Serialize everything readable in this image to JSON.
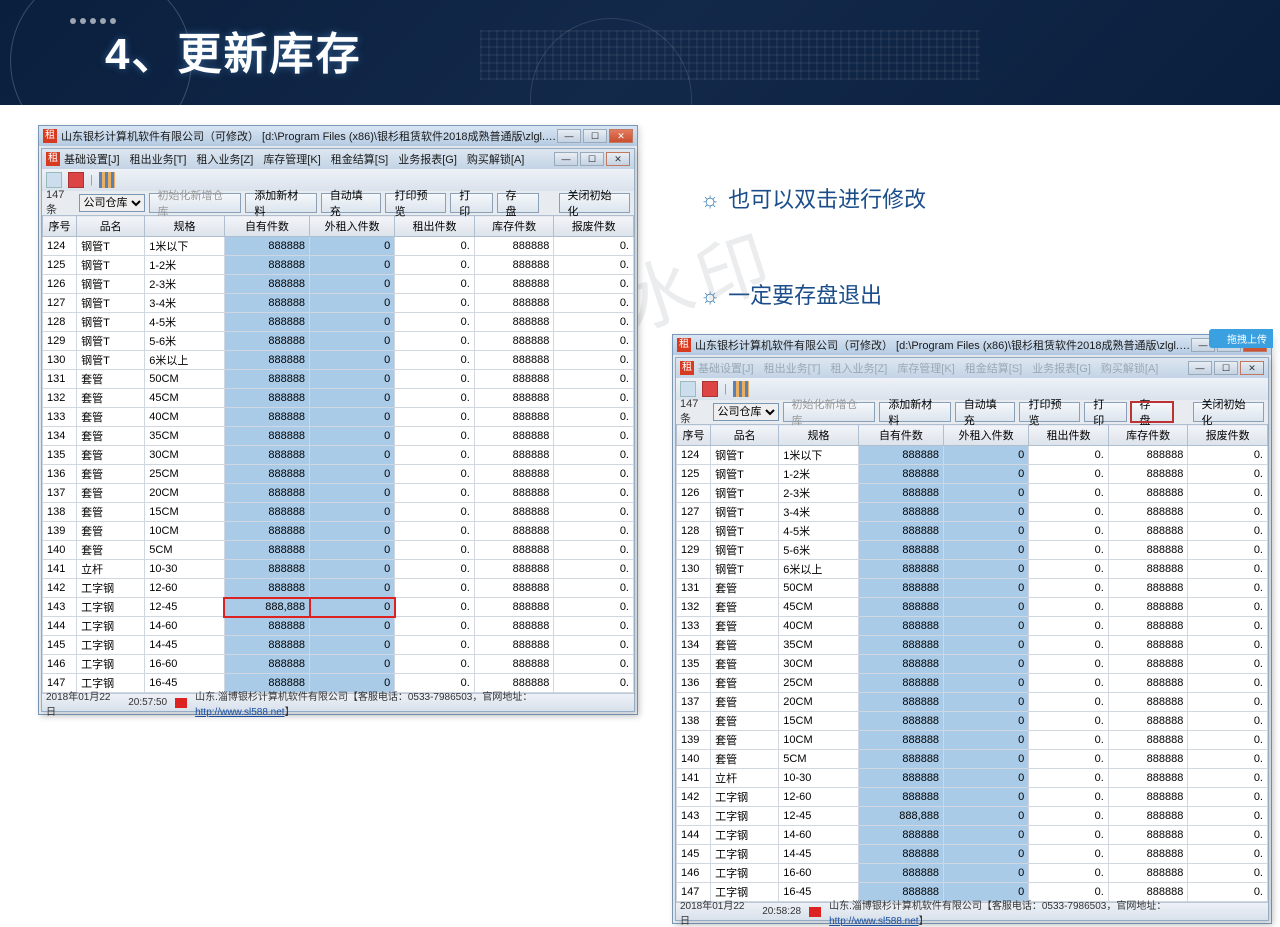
{
  "slide_title": "4、更新库存",
  "annotation1": "也可以双击进行修改",
  "annotation2": "一定要存盘退出",
  "app": {
    "outer_title": "山东银杉计算机软件有限公司（可修改）    [d:\\Program Files (x86)\\银杉租赁软件2018成熟普通版\\zlgl.db] - [即时库存录入]",
    "menus": [
      "基础设置[J]",
      "租出业务[T]",
      "租入业务[Z]",
      "库存管理[K]",
      "租金结算[S]",
      "业务报表[G]",
      "购买解锁[A]"
    ],
    "count": "147条",
    "warehouse": "公司仓库",
    "buttons": {
      "init": "初始化新增仓库",
      "add_material": "添加新材料",
      "auto_fill": "自动填充",
      "print_preview": "打印预览",
      "print": "打  印",
      "save": "存  盘",
      "close_init": "关闭初始化"
    },
    "columns": [
      "序号",
      "品名",
      "规格",
      "自有件数",
      "外租入件数",
      "租出件数",
      "库存件数",
      "报废件数"
    ],
    "rows": [
      {
        "no": "124",
        "name": "钢管T",
        "spec": "1米以下",
        "own": "888888",
        "rentin": "0",
        "rentout": "0.",
        "stock": "888888",
        "scrap": "0."
      },
      {
        "no": "125",
        "name": "钢管T",
        "spec": "1-2米",
        "own": "888888",
        "rentin": "0",
        "rentout": "0.",
        "stock": "888888",
        "scrap": "0."
      },
      {
        "no": "126",
        "name": "钢管T",
        "spec": "2-3米",
        "own": "888888",
        "rentin": "0",
        "rentout": "0.",
        "stock": "888888",
        "scrap": "0."
      },
      {
        "no": "127",
        "name": "钢管T",
        "spec": "3-4米",
        "own": "888888",
        "rentin": "0",
        "rentout": "0.",
        "stock": "888888",
        "scrap": "0."
      },
      {
        "no": "128",
        "name": "钢管T",
        "spec": "4-5米",
        "own": "888888",
        "rentin": "0",
        "rentout": "0.",
        "stock": "888888",
        "scrap": "0."
      },
      {
        "no": "129",
        "name": "钢管T",
        "spec": "5-6米",
        "own": "888888",
        "rentin": "0",
        "rentout": "0.",
        "stock": "888888",
        "scrap": "0."
      },
      {
        "no": "130",
        "name": "钢管T",
        "spec": "6米以上",
        "own": "888888",
        "rentin": "0",
        "rentout": "0.",
        "stock": "888888",
        "scrap": "0."
      },
      {
        "no": "131",
        "name": "套管",
        "spec": "50CM",
        "own": "888888",
        "rentin": "0",
        "rentout": "0.",
        "stock": "888888",
        "scrap": "0."
      },
      {
        "no": "132",
        "name": "套管",
        "spec": "45CM",
        "own": "888888",
        "rentin": "0",
        "rentout": "0.",
        "stock": "888888",
        "scrap": "0."
      },
      {
        "no": "133",
        "name": "套管",
        "spec": "40CM",
        "own": "888888",
        "rentin": "0",
        "rentout": "0.",
        "stock": "888888",
        "scrap": "0."
      },
      {
        "no": "134",
        "name": "套管",
        "spec": "35CM",
        "own": "888888",
        "rentin": "0",
        "rentout": "0.",
        "stock": "888888",
        "scrap": "0."
      },
      {
        "no": "135",
        "name": "套管",
        "spec": "30CM",
        "own": "888888",
        "rentin": "0",
        "rentout": "0.",
        "stock": "888888",
        "scrap": "0."
      },
      {
        "no": "136",
        "name": "套管",
        "spec": "25CM",
        "own": "888888",
        "rentin": "0",
        "rentout": "0.",
        "stock": "888888",
        "scrap": "0."
      },
      {
        "no": "137",
        "name": "套管",
        "spec": "20CM",
        "own": "888888",
        "rentin": "0",
        "rentout": "0.",
        "stock": "888888",
        "scrap": "0."
      },
      {
        "no": "138",
        "name": "套管",
        "spec": "15CM",
        "own": "888888",
        "rentin": "0",
        "rentout": "0.",
        "stock": "888888",
        "scrap": "0."
      },
      {
        "no": "139",
        "name": "套管",
        "spec": "10CM",
        "own": "888888",
        "rentin": "0",
        "rentout": "0.",
        "stock": "888888",
        "scrap": "0."
      },
      {
        "no": "140",
        "name": "套管",
        "spec": "5CM",
        "own": "888888",
        "rentin": "0",
        "rentout": "0.",
        "stock": "888888",
        "scrap": "0."
      },
      {
        "no": "141",
        "name": "立杆",
        "spec": "10-30",
        "own": "888888",
        "rentin": "0",
        "rentout": "0.",
        "stock": "888888",
        "scrap": "0."
      },
      {
        "no": "142",
        "name": "工字钢",
        "spec": "12-60",
        "own": "888888",
        "rentin": "0",
        "rentout": "0.",
        "stock": "888888",
        "scrap": "0."
      },
      {
        "no": "143",
        "name": "工字钢",
        "spec": "12-45",
        "own": "888,888",
        "rentin": "0",
        "rentout": "0.",
        "stock": "888888",
        "scrap": "0.",
        "highlight": true
      },
      {
        "no": "144",
        "name": "工字钢",
        "spec": "14-60",
        "own": "888888",
        "rentin": "0",
        "rentout": "0.",
        "stock": "888888",
        "scrap": "0."
      },
      {
        "no": "145",
        "name": "工字钢",
        "spec": "14-45",
        "own": "888888",
        "rentin": "0",
        "rentout": "0.",
        "stock": "888888",
        "scrap": "0."
      },
      {
        "no": "146",
        "name": "工字钢",
        "spec": "16-60",
        "own": "888888",
        "rentin": "0",
        "rentout": "0.",
        "stock": "888888",
        "scrap": "0."
      },
      {
        "no": "147",
        "name": "工字钢",
        "spec": "16-45",
        "own": "888888",
        "rentin": "0",
        "rentout": "0.",
        "stock": "888888",
        "scrap": "0."
      }
    ]
  },
  "status": {
    "date1": "2018年01月22日",
    "time1": "20:57:50",
    "date2": "2018年01月22日",
    "time2": "20:58:28",
    "company": "山东.淄博银杉计算机软件有限公司【客服电话：0533-7986503，官网地址：",
    "url": "http://www.sl588.net",
    "closer": "】"
  },
  "upload_tag": "拖拽上传"
}
